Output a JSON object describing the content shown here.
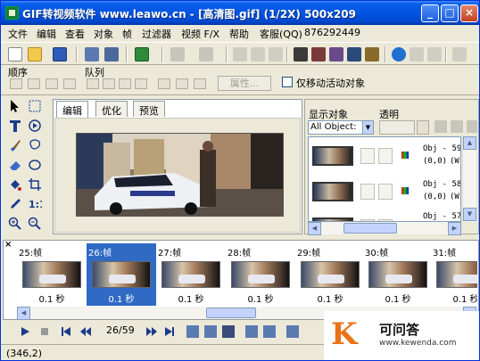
{
  "window": {
    "title": "GIF转视频软件 www.leawo.cn - [高清图.gif] (1/2X)  500x209",
    "buttons": [
      "_",
      "□",
      "×"
    ]
  },
  "menu": [
    "文件",
    "编辑",
    "查看",
    "对象",
    "帧",
    "过滤器",
    "视频 F/X",
    "帮助",
    "客服(QQ)",
    "876292449"
  ],
  "toolbar2": {
    "order_label": "顺序",
    "queue_label": "队列",
    "properties_button": "属性...",
    "only_move_active_label": "仅移动活动对象"
  },
  "tabs": [
    "编辑",
    "优化",
    "预览"
  ],
  "right_panel": {
    "show_objects_label": "显示对象",
    "transparency_label": "透明",
    "select_value": "All Object:",
    "objects": [
      {
        "name": "Obj - 59",
        "coords": "(0,0)",
        "extra": "(W:"
      },
      {
        "name": "Obj - 58",
        "coords": "(0,0)",
        "extra": "(W:"
      },
      {
        "name": "Obj - 57",
        "coords": "",
        "extra": ""
      }
    ]
  },
  "frames": [
    {
      "label": "25:帧",
      "duration": "0.1 秒",
      "selected": false
    },
    {
      "label": "26:帧",
      "duration": "0.1 秒",
      "selected": true
    },
    {
      "label": "27:帧",
      "duration": "0.1 秒",
      "selected": false
    },
    {
      "label": "28:帧",
      "duration": "0.1 秒",
      "selected": false
    },
    {
      "label": "29:帧",
      "duration": "0.1 秒",
      "selected": false
    },
    {
      "label": "30:帧",
      "duration": "0.1 秒",
      "selected": false
    },
    {
      "label": "31:帧",
      "duration": "0.1 秒",
      "selected": false
    }
  ],
  "playback": {
    "frame_counter": "26/59"
  },
  "status": {
    "coords": "(346,2)"
  },
  "watermark": {
    "logo_letter": "K",
    "title": "可问答",
    "url": "www.kewenda.com"
  },
  "colors": {
    "titlebar": "#0054E3",
    "selection": "#316AC5",
    "window_bg": "#ECE9D8",
    "watermark_accent": "#E8731A"
  }
}
